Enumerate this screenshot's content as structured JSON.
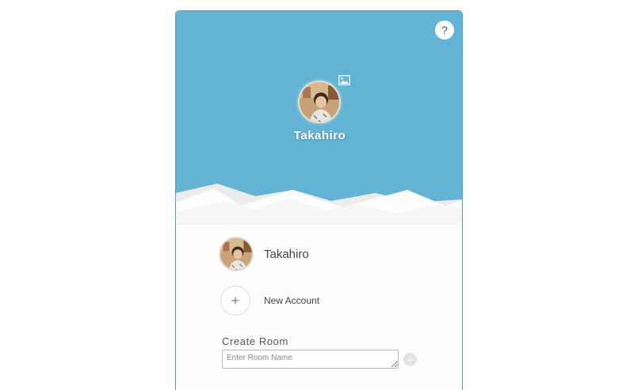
{
  "header": {
    "help_label": "?",
    "profile_name": "Takahiro",
    "background_color": "#62b3d4"
  },
  "accounts": [
    {
      "name": "Takahiro"
    }
  ],
  "new_account": {
    "plus_label": "+",
    "label": "New Account"
  },
  "create_room": {
    "label": "Create Room",
    "placeholder": "Enter Room Name",
    "value": "",
    "add_label": "+"
  },
  "icons": {
    "help": "question-mark-icon",
    "change_image": "image-icon",
    "add": "plus-icon"
  }
}
